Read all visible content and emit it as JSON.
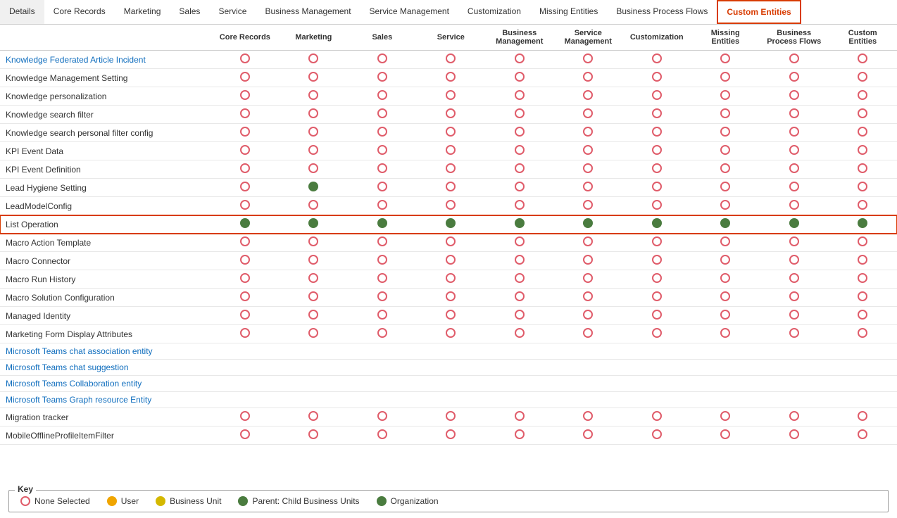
{
  "tabs": [
    {
      "label": "Details",
      "active": false
    },
    {
      "label": "Core Records",
      "active": false
    },
    {
      "label": "Marketing",
      "active": false
    },
    {
      "label": "Sales",
      "active": false
    },
    {
      "label": "Service",
      "active": false
    },
    {
      "label": "Business Management",
      "active": false
    },
    {
      "label": "Service Management",
      "active": false
    },
    {
      "label": "Customization",
      "active": false
    },
    {
      "label": "Missing Entities",
      "active": false
    },
    {
      "label": "Business Process Flows",
      "active": false
    },
    {
      "label": "Custom Entities",
      "active": true
    }
  ],
  "columns": [
    "",
    "Core Records",
    "Marketing",
    "Sales",
    "Service",
    "Business Management",
    "Service Management",
    "Customization",
    "Missing Entities",
    "Business Process Flows",
    "Custom Entities"
  ],
  "rows": [
    {
      "name": "Knowledge Federated Article Incident",
      "nameType": "blue",
      "cells": [
        "none",
        "none",
        "none",
        "none",
        "none",
        "none",
        "none",
        "none",
        "none",
        "none"
      ]
    },
    {
      "name": "Knowledge Management Setting",
      "nameType": "black",
      "cells": [
        "none",
        "none",
        "none",
        "none",
        "none",
        "none",
        "none",
        "none",
        "none",
        "none"
      ]
    },
    {
      "name": "Knowledge personalization",
      "nameType": "black",
      "cells": [
        "none",
        "none",
        "none",
        "none",
        "none",
        "none",
        "none",
        "none",
        "none",
        "none"
      ]
    },
    {
      "name": "Knowledge search filter",
      "nameType": "black",
      "cells": [
        "none",
        "none",
        "none",
        "none",
        "none",
        "none",
        "none",
        "none",
        "none",
        "none"
      ]
    },
    {
      "name": "Knowledge search personal filter config",
      "nameType": "black",
      "cells": [
        "none",
        "none",
        "none",
        "none",
        "none",
        "none",
        "none",
        "none",
        "none",
        "none"
      ]
    },
    {
      "name": "KPI Event Data",
      "nameType": "black",
      "cells": [
        "none",
        "none",
        "none",
        "none",
        "none",
        "none",
        "none",
        "none",
        "none",
        "none"
      ]
    },
    {
      "name": "KPI Event Definition",
      "nameType": "black",
      "cells": [
        "none",
        "none",
        "none",
        "none",
        "none",
        "none",
        "none",
        "none",
        "none",
        "none"
      ]
    },
    {
      "name": "Lead Hygiene Setting",
      "nameType": "black",
      "cells": [
        "none",
        "org",
        "none",
        "none",
        "none",
        "none",
        "none",
        "none",
        "none",
        "none"
      ]
    },
    {
      "name": "LeadModelConfig",
      "nameType": "black",
      "cells": [
        "none",
        "none",
        "none",
        "none",
        "none",
        "none",
        "none",
        "none",
        "none",
        "none"
      ]
    },
    {
      "name": "List Operation",
      "nameType": "black",
      "highlighted": true,
      "cells": [
        "org",
        "org",
        "org",
        "org",
        "org",
        "org",
        "org",
        "org",
        "org",
        "org"
      ]
    },
    {
      "name": "Macro Action Template",
      "nameType": "black",
      "cells": [
        "none",
        "none",
        "none",
        "none",
        "none",
        "none",
        "none",
        "none",
        "none",
        "none"
      ]
    },
    {
      "name": "Macro Connector",
      "nameType": "black",
      "cells": [
        "none",
        "none",
        "none",
        "none",
        "none",
        "none",
        "none",
        "none",
        "none",
        "none"
      ]
    },
    {
      "name": "Macro Run History",
      "nameType": "black",
      "cells": [
        "none",
        "none",
        "none",
        "none",
        "none",
        "none",
        "none",
        "none",
        "none",
        "none"
      ]
    },
    {
      "name": "Macro Solution Configuration",
      "nameType": "black",
      "cells": [
        "none",
        "none",
        "none",
        "none",
        "none",
        "none",
        "none",
        "none",
        "none",
        "none"
      ]
    },
    {
      "name": "Managed Identity",
      "nameType": "black",
      "cells": [
        "none",
        "none",
        "none",
        "none",
        "none",
        "none",
        "none",
        "none",
        "none",
        "none"
      ]
    },
    {
      "name": "Marketing Form Display Attributes",
      "nameType": "black",
      "cells": [
        "none",
        "none",
        "none",
        "none",
        "none",
        "none",
        "none",
        "none",
        "none",
        "none"
      ]
    },
    {
      "name": "Microsoft Teams chat association entity",
      "nameType": "blue",
      "cells": [
        null,
        null,
        null,
        null,
        null,
        null,
        null,
        null,
        null,
        null
      ]
    },
    {
      "name": "Microsoft Teams chat suggestion",
      "nameType": "blue",
      "cells": [
        null,
        null,
        null,
        null,
        null,
        null,
        null,
        null,
        null,
        null
      ]
    },
    {
      "name": "Microsoft Teams Collaboration entity",
      "nameType": "blue",
      "cells": [
        null,
        null,
        null,
        null,
        null,
        null,
        null,
        null,
        null,
        null
      ]
    },
    {
      "name": "Microsoft Teams Graph resource Entity",
      "nameType": "blue",
      "cells": [
        null,
        null,
        null,
        null,
        null,
        null,
        null,
        null,
        null,
        null
      ]
    },
    {
      "name": "Migration tracker",
      "nameType": "black",
      "cells": [
        "none",
        "none",
        "none",
        "none",
        "none",
        "none",
        "none",
        "none",
        "none",
        "none"
      ]
    },
    {
      "name": "MobileOfflineProfileItemFilter",
      "nameType": "black",
      "cells": [
        "none",
        "none",
        "none",
        "none",
        "none",
        "none",
        "none",
        "none",
        "none",
        "none"
      ]
    }
  ],
  "key": {
    "title": "Key",
    "items": [
      {
        "label": "None Selected",
        "type": "none"
      },
      {
        "label": "User",
        "type": "user"
      },
      {
        "label": "Business Unit",
        "type": "bu"
      },
      {
        "label": "Parent: Child Business Units",
        "type": "parent"
      },
      {
        "label": "Organization",
        "type": "org"
      }
    ]
  }
}
